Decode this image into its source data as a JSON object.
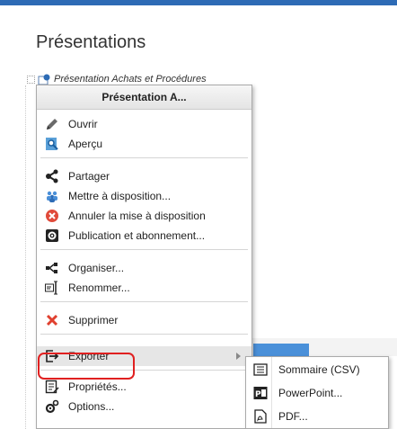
{
  "page": {
    "title": "Présentations"
  },
  "tree": {
    "item_label": "Présentation Achats et Procédures"
  },
  "menu": {
    "header": "Présentation A...",
    "items": [
      {
        "label": "Ouvrir",
        "icon": "pencil-icon"
      },
      {
        "label": "Aperçu",
        "icon": "preview-icon"
      },
      {
        "label": "Partager",
        "icon": "share-icon"
      },
      {
        "label": "Mettre à disposition...",
        "icon": "users-icon"
      },
      {
        "label": "Annuler la mise à disposition",
        "icon": "cancel-icon"
      },
      {
        "label": "Publication et abonnement...",
        "icon": "gear-icon"
      },
      {
        "label": "Organiser...",
        "icon": "organize-icon"
      },
      {
        "label": "Renommer...",
        "icon": "rename-icon"
      },
      {
        "label": "Supprimer",
        "icon": "delete-icon"
      },
      {
        "label": "Exporter",
        "icon": "export-icon"
      },
      {
        "label": "Propriétés...",
        "icon": "properties-icon"
      },
      {
        "label": "Options...",
        "icon": "options-icon"
      }
    ]
  },
  "submenu": {
    "items": [
      {
        "label": "Sommaire (CSV)",
        "icon": "csv-icon"
      },
      {
        "label": "PowerPoint...",
        "icon": "powerpoint-icon"
      },
      {
        "label": "PDF...",
        "icon": "pdf-icon"
      }
    ]
  },
  "colors": {
    "accent": "#2d6bb5",
    "highlight": "#e02020"
  }
}
